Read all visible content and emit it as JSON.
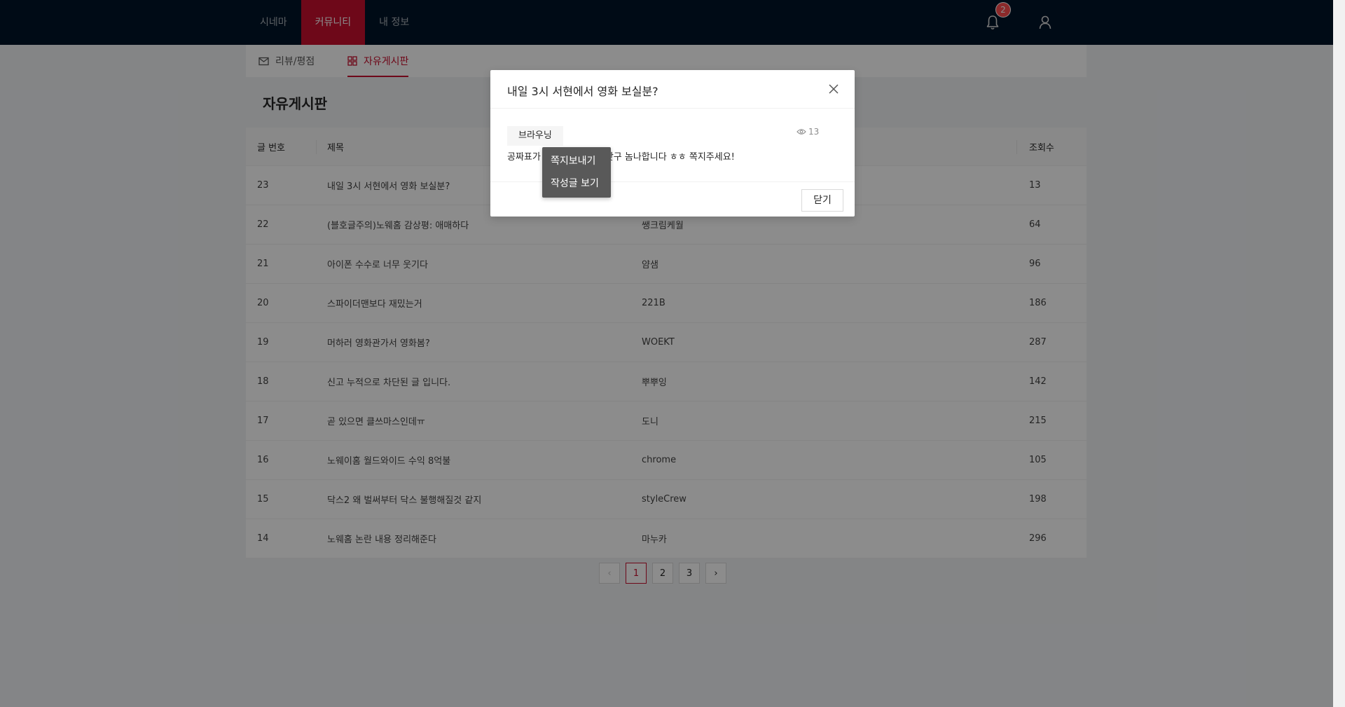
{
  "header": {
    "nav": [
      {
        "label": "시네마",
        "active": false
      },
      {
        "label": "커뮤니티",
        "active": true
      },
      {
        "label": "내 정보",
        "active": false
      }
    ],
    "notification_count": "2",
    "icons": [
      "bell-icon",
      "user-icon"
    ]
  },
  "subnav": {
    "tabs": [
      {
        "label": "리뷰/평점",
        "icon": "mail-icon"
      },
      {
        "label": "자유게시판",
        "icon": "grid-icon",
        "active": true
      }
    ]
  },
  "board": {
    "title": "자유게시판",
    "columns": [
      "글 번호",
      "제목",
      "",
      "조회수"
    ],
    "rows": [
      {
        "no": "23",
        "title": "내일 3시 서현에서 영화 보실분?",
        "author": "",
        "views": "13"
      },
      {
        "no": "22",
        "title": "(블호글주의)노웨홈 감상평: 애매하다",
        "author": "쌩크림케월",
        "views": "64"
      },
      {
        "no": "21",
        "title": "아이폰 수수로 너무 웃기다",
        "author": "얌샘",
        "views": "96"
      },
      {
        "no": "20",
        "title": "스파이더맨보다 재밌는거",
        "author": "221B",
        "views": "186"
      },
      {
        "no": "19",
        "title": "머하러 영화관가서 영화봄?",
        "author": "WOEKT",
        "views": "287"
      },
      {
        "no": "18",
        "title": "신고 누적으로 차단된 글 입니다.",
        "author": "뿌뿌잉",
        "views": "142"
      },
      {
        "no": "17",
        "title": "곧 있으면 클쓰마스인데ㅠ",
        "author": "도니",
        "views": "215"
      },
      {
        "no": "16",
        "title": "노웨이홈 월드와이드 수익 8억불",
        "author": "chrome",
        "views": "105"
      },
      {
        "no": "15",
        "title": "닥스2 왜 벌써부터 닥스 불행해질것 같지",
        "author": "styleCrew",
        "views": "198"
      },
      {
        "no": "14",
        "title": "노웨홈 논란 내용 정리해준다",
        "author": "마누카",
        "views": "296"
      }
    ]
  },
  "pagination": {
    "prev": "‹",
    "pages": [
      "1",
      "2",
      "3"
    ],
    "current": "1",
    "next": "›"
  },
  "modal": {
    "title": "내일 3시 서현에서 영화 보실분?",
    "author": "브라우닝",
    "views": "13",
    "content_start": "공짜표가",
    "content_end": "간이 안돼갖구 놈나합니다 ㅎㅎ 쪽지주세요!",
    "close_button": "닫기"
  },
  "context_menu": {
    "items": [
      "쪽지보내기",
      "작성글 보기"
    ]
  },
  "colors": {
    "accent": "#c8102e",
    "header_bg": "#001529"
  }
}
